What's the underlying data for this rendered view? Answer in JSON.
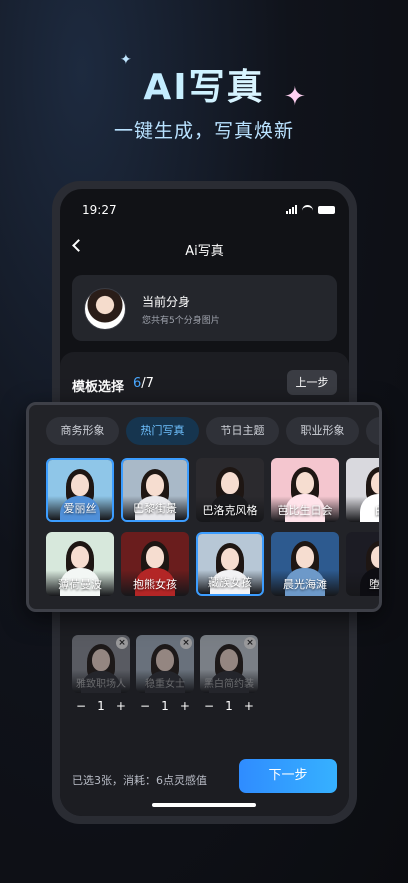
{
  "hero": {
    "title": "AI写真",
    "subtitle": "一键生成，写真焕新"
  },
  "status_bar": {
    "time": "19:27"
  },
  "nav": {
    "title": "Ai写真"
  },
  "avatar_card": {
    "title": "当前分身",
    "description": "您共有5个分身图片"
  },
  "template": {
    "label": "模板选择",
    "count_current": "6",
    "count_total": "/7",
    "prev_label": "上一步"
  },
  "popup": {
    "tabs": [
      {
        "label": "商务形象",
        "active": false
      },
      {
        "label": "热门写真",
        "active": true
      },
      {
        "label": "节日主题",
        "active": false
      },
      {
        "label": "职业形象",
        "active": false
      }
    ],
    "row1": [
      {
        "label": "爱丽丝",
        "selected": true,
        "bg": "#8fc6e8",
        "outfit": "#4f8fd8"
      },
      {
        "label": "巴黎街景",
        "selected": true,
        "bg": "#a9b9c8",
        "outfit": "#e8e8ec"
      },
      {
        "label": "巴洛克风格",
        "selected": false,
        "bg": "#2b2a2e",
        "outfit": "#1a1a1d"
      },
      {
        "label": "芭比生日会",
        "selected": false,
        "bg": "#f4c6cf",
        "outfit": "#ffe3ea"
      },
      {
        "label": "白",
        "selected": false,
        "bg": "#d9d9de",
        "outfit": "#ffffff"
      }
    ],
    "row2": [
      {
        "label": "薄荷曼波",
        "selected": false,
        "bg": "#d7e8dc",
        "outfit": "#f3f7f5"
      },
      {
        "label": "抱熊女孩",
        "selected": false,
        "bg": "#6a1d1d",
        "outfit": "#b32626"
      },
      {
        "label": "藏族女孩",
        "selected": true,
        "bg": "#b7c7d6",
        "outfit": "#f2f2f4"
      },
      {
        "label": "晨光海滩",
        "selected": false,
        "bg": "#2d5a8f",
        "outfit": "#6d99c9"
      },
      {
        "label": "堕落",
        "selected": false,
        "bg": "#1c1c24",
        "outfit": "#0d0d12"
      }
    ]
  },
  "selected_items": [
    {
      "name": "雅致职场人",
      "qty": "1",
      "bg": "#8b8f98"
    },
    {
      "name": "稳重女士",
      "qty": "1",
      "bg": "#a8b7c6"
    },
    {
      "name": "黑白简约装",
      "qty": "1",
      "bg": "#c8d0d9"
    }
  ],
  "stepper": {
    "minus": "−",
    "plus": "+"
  },
  "bottom": {
    "consume_text": "已选3张，消耗：6点灵感值",
    "next_label": "下一步"
  },
  "colors": {
    "accent": "#3c9dff",
    "tab_active_bg": "#16354f",
    "tab_active_text": "#6fc1ff"
  }
}
